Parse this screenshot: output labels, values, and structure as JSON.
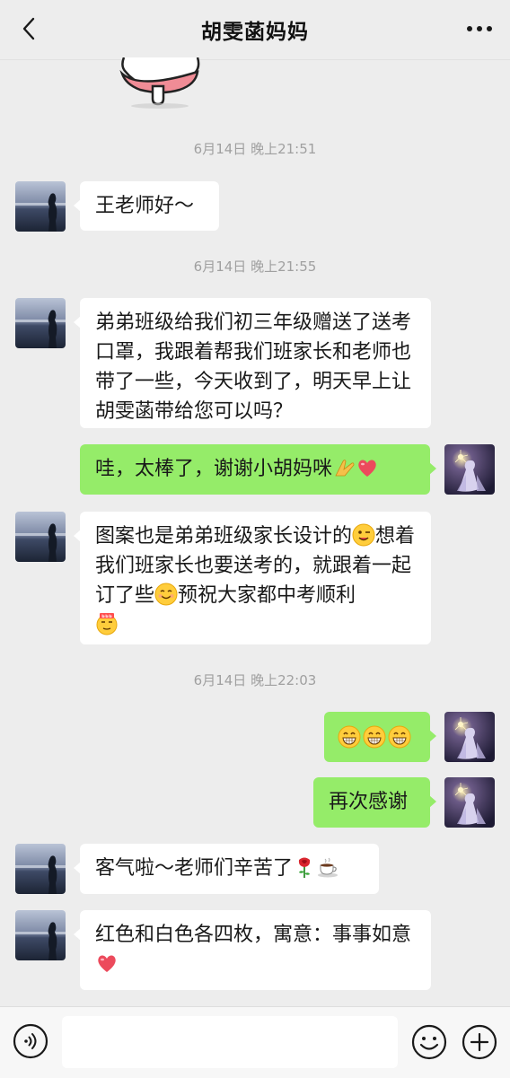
{
  "header": {
    "title": "胡雯菡妈妈",
    "back_icon": "chevron-left-icon",
    "more_icon": "more-dots-icon"
  },
  "colors": {
    "background": "#ededed",
    "incoming_bubble": "#ffffff",
    "outgoing_bubble": "#95ec69",
    "timestamp_text": "#a0a0a0"
  },
  "timestamps": [
    "6月14日 晚上21:51",
    "6月14日 晚上21:55",
    "6月14日 晚上22:03"
  ],
  "messages": [
    {
      "from": "other",
      "text": "王老师好～"
    },
    {
      "from": "other",
      "text": "弟弟班级给我们初三年级赠送了送考口罩，我跟着帮我们班家长和老师也带了一些，今天收到了，明天早上让胡雯菡带给您可以吗？"
    },
    {
      "from": "me",
      "text": "哇，太棒了，谢谢小胡妈咪",
      "emojis": [
        "praying-hands-emoji",
        "heart-emoji"
      ]
    },
    {
      "from": "other",
      "text_parts": [
        "图案也是弟弟班级家长设计的",
        "想着我们班家长也要送考的，就跟着一起订了些",
        "预祝大家都中考顺利"
      ],
      "emojis": [
        "wink-emoji",
        "smile-emoji",
        "666-emoji"
      ]
    },
    {
      "from": "me",
      "text": "",
      "emojis": [
        "grin-emoji",
        "grin-emoji",
        "grin-emoji"
      ]
    },
    {
      "from": "me",
      "text": "再次感谢"
    },
    {
      "from": "other",
      "text": "客气啦～老师们辛苦了",
      "emojis": [
        "rose-emoji",
        "coffee-emoji"
      ]
    },
    {
      "from": "other",
      "text": "红色和白色各四枚，寓意：事事如意",
      "emojis": [
        "heart-emoji"
      ]
    }
  ],
  "input_bar": {
    "voice_icon": "voice-icon",
    "emoji_icon": "emoji-face-icon",
    "plus_icon": "plus-icon",
    "value": ""
  }
}
